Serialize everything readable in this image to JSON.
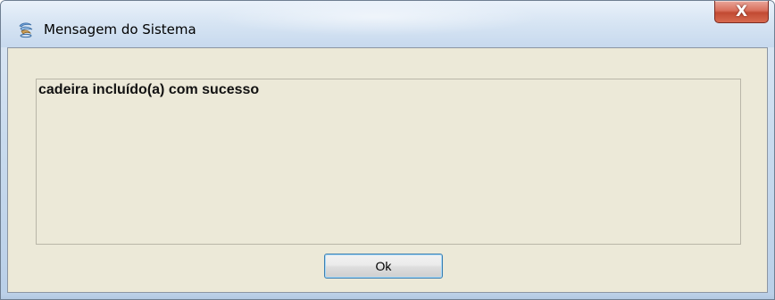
{
  "window": {
    "title": "Mensagem do Sistema",
    "close_label": "X"
  },
  "message": {
    "text": "cadeira incluído(a) com sucesso"
  },
  "buttons": {
    "ok_label": "Ok"
  },
  "icons": {
    "app_icon": "java-app-icon",
    "close_icon": "close-icon"
  },
  "colors": {
    "dialog_background": "#ece9d8",
    "close_button": "#c24a33",
    "titlebar": "#d6e4f3"
  }
}
